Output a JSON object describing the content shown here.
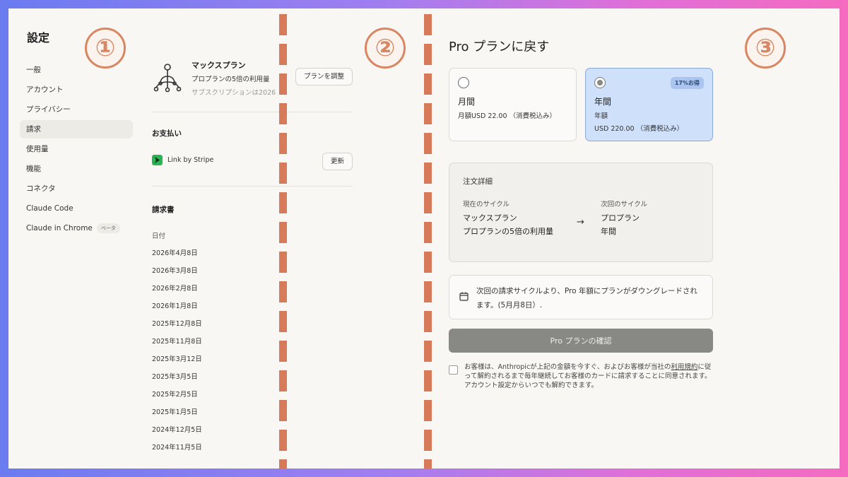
{
  "annotations": {
    "one": "①",
    "two": "②",
    "three": "③"
  },
  "sidebar": {
    "title": "設定",
    "items": [
      {
        "label": "一般"
      },
      {
        "label": "アカウント"
      },
      {
        "label": "プライバシー"
      },
      {
        "label": "請求"
      },
      {
        "label": "使用量"
      },
      {
        "label": "機能"
      },
      {
        "label": "コネクタ"
      },
      {
        "label": "Claude Code"
      },
      {
        "label": "Claude in Chrome",
        "badge": "ベータ"
      }
    ],
    "active_index": 3
  },
  "plan": {
    "name": "マックスプラン",
    "description": "プロプランの5倍の利用量",
    "subscription_note": "サブスクリプションは2026",
    "adjust_button": "プランを調整"
  },
  "payment": {
    "title": "お支払い",
    "method": "Link by Stripe",
    "update_button": "更新"
  },
  "invoices": {
    "title": "請求書",
    "column_date": "日付",
    "dates": [
      "2026年4月8日",
      "2026年3月8日",
      "2026年2月8日",
      "2026年1月8日",
      "2025年12月8日",
      "2025年11月8日",
      "2025年3月12日",
      "2025年3月5日",
      "2025年2月5日",
      "2025年1月5日",
      "2024年12月5日",
      "2024年11月5日"
    ]
  },
  "downgrade": {
    "title": "Pro プランに戻す",
    "monthly": {
      "name": "月間",
      "price": "月額USD 22.00 （消費税込み）"
    },
    "yearly": {
      "name": "年間",
      "label": "年額",
      "price": "USD 220.00 （消費税込み）",
      "badge": "17%お得"
    },
    "order": {
      "title": "注文詳細",
      "current_label": "現在のサイクル",
      "current_plan": "マックスプラン",
      "current_desc": "プロプランの5倍の利用量",
      "next_label": "次回のサイクル",
      "next_plan": "プロプラン",
      "next_period": "年間"
    },
    "notice": "次回の請求サイクルより、Pro 年額にプランがダウングレードされます。(5月月8日）.",
    "confirm_button": "Pro プランの確認",
    "terms_before": "お客様は、Anthropicが上記の金額を今すぐ、およびお客様が当社の",
    "terms_link": "利用規約",
    "terms_after": "に従って解約されるまで毎年継続してお客様のカードに請求することに同意されます。アカウント設定からいつでも解約できます。"
  },
  "colors": {
    "accent": "#d77a5a",
    "selected_card": "#cfe0fb",
    "stripe": "#2bb255"
  }
}
